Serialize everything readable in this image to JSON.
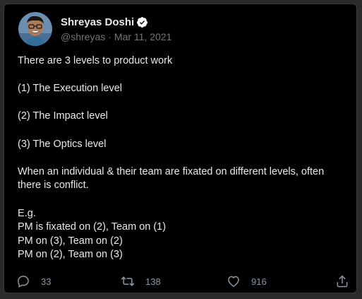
{
  "author": {
    "display_name": "Shreyas Doshi",
    "handle": "@shreyas",
    "separator": "·",
    "date": "Mar 11, 2021"
  },
  "tweet": {
    "paragraphs": [
      "There are 3 levels to product work",
      "(1) The Execution level",
      "(2) The Impact level",
      "(3) The Optics level",
      "When an individual & their team are fixated on different levels, often there is conflict.",
      "E.g.\nPM is fixated on (2), Team on (1)\nPM on (3), Team on (2)\nPM on (2), Team on (3)"
    ]
  },
  "actions": {
    "reply_count": "33",
    "retweet_count": "138",
    "like_count": "916"
  },
  "icons": {
    "verified": "verified-badge-icon",
    "reply": "reply-icon",
    "retweet": "retweet-icon",
    "like": "heart-icon",
    "share": "share-icon"
  },
  "colors": {
    "background": "#000000",
    "text": "#e7e9ea",
    "muted": "#71767b",
    "action": "#8b98a5",
    "verified": "#ffffff"
  }
}
